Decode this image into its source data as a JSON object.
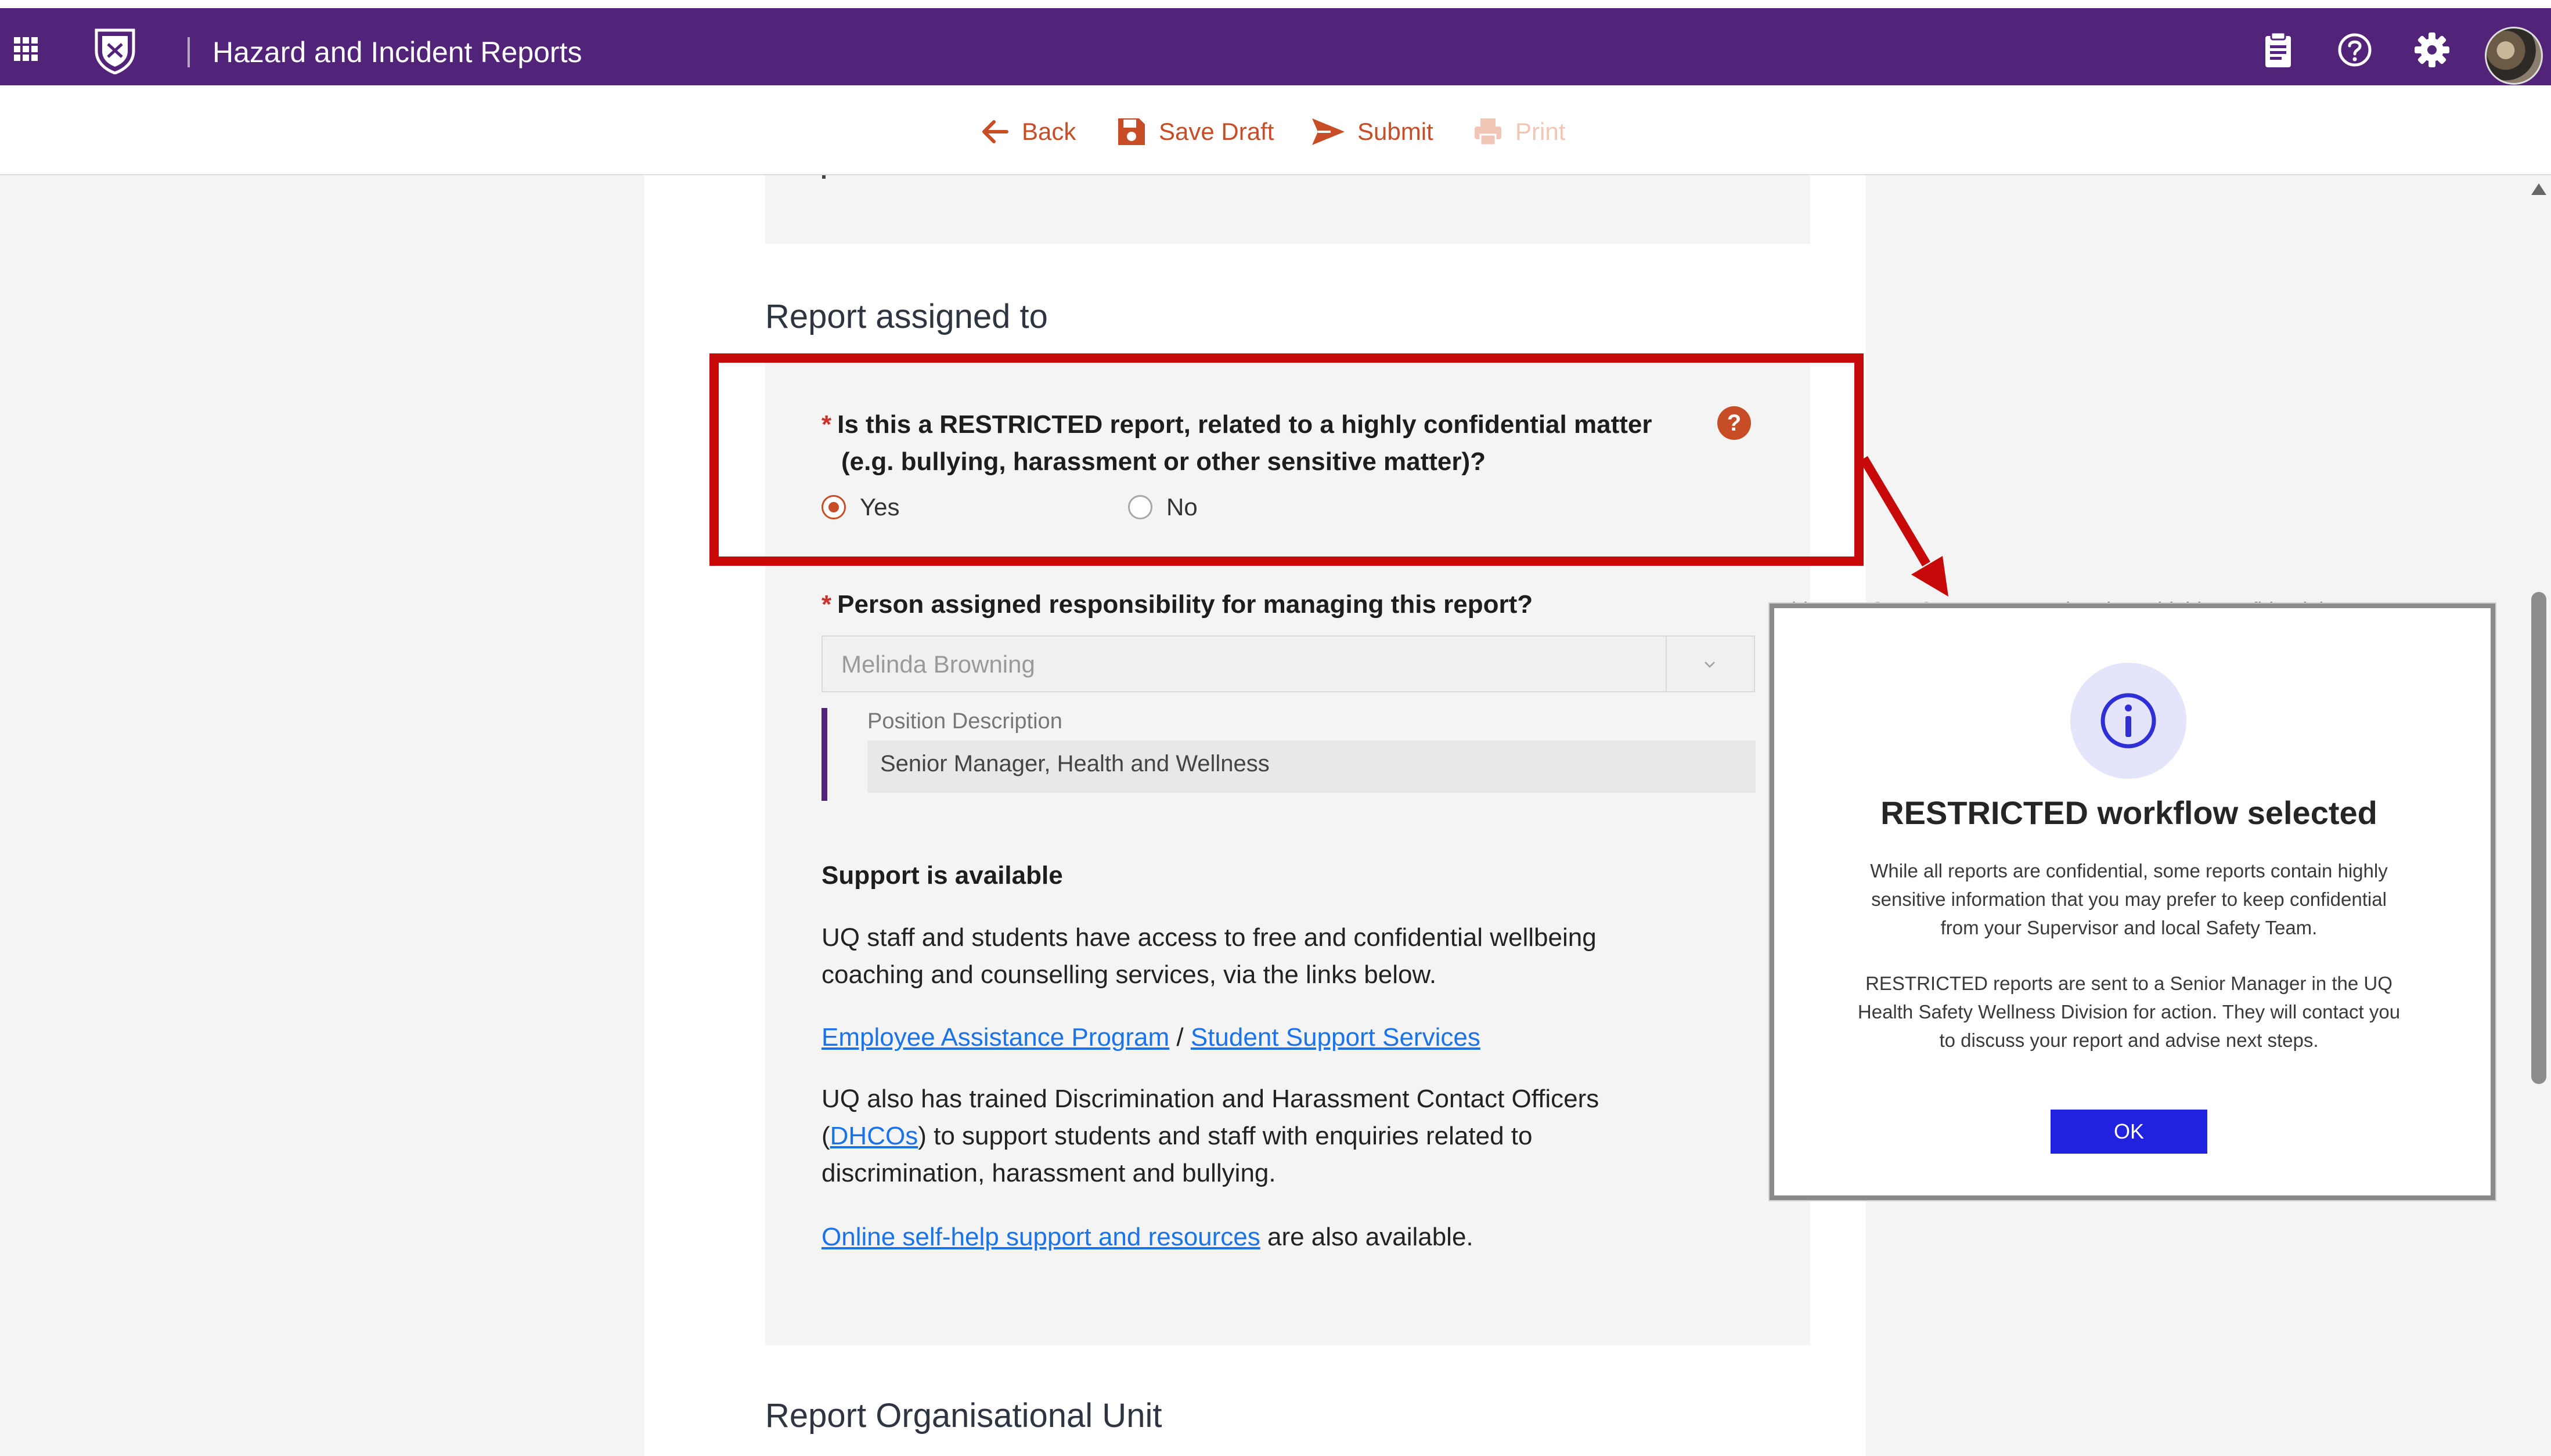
{
  "app": {
    "title": "Hazard and Incident Reports"
  },
  "toolbar": {
    "back_label": "Back",
    "save_label": "Save Draft",
    "submit_label": "Submit",
    "print_label": "Print"
  },
  "sections": {
    "assigned_title": "Report assigned to",
    "org_unit_title": "Report Organisational Unit"
  },
  "restricted_question": {
    "label_line1": "Is this a RESTRICTED report, related to a highly confidential matter",
    "label_line2": "(e.g. bullying, harassment or other sensitive matter)?",
    "help_glyph": "?",
    "options": [
      {
        "label": "Yes",
        "checked": true
      },
      {
        "label": "No",
        "checked": false
      }
    ]
  },
  "person_question": {
    "label": "Person assigned responsibility for managing this report?",
    "selected_value": "Melinda Browning",
    "position_label": "Position Description",
    "position_value": "Senior Manager, Health and Wellness"
  },
  "support": {
    "title": "Support is available",
    "para1_line1": "UQ staff and students have access to free and confidential wellbeing",
    "para1_line2": "coaching and counselling services, via the links below.",
    "link_eap": "Employee Assistance Program",
    "link_sep": "/",
    "link_sss": "Student Support Services",
    "para2_line1": "UQ also has trained Discrimination and Harassment Contact Officers",
    "para2_open": "(",
    "link_dhco": "DHCOs",
    "para2_line2_rest": ") to support students and staff with enquiries related to",
    "para2_line3": "discrimination, harassment and bullying.",
    "link_online": "Online self-help support and resources",
    "para3_rest": " are also available."
  },
  "modal": {
    "ghost_text": "s this a RESTRICTED report, related to a highly confidential matter",
    "title": "RESTRICTED workflow selected",
    "para1_line1": "While all reports are confidential, some reports contain highly",
    "para1_line2": "sensitive information that you may prefer to keep confidential",
    "para1_line3": "from your Supervisor and local Safety Team.",
    "para2_line1": "RESTRICTED reports are sent to a Senior Manager in the UQ",
    "para2_line2": "Health Safety Wellness Division for action. They will contact you",
    "para2_line3": "to discuss your report and advise next steps.",
    "ok_label": "OK"
  },
  "colors": {
    "brand_purple": "#51247a",
    "accent_orange": "#c64d25",
    "highlight_red": "#c8090a",
    "modal_button_blue": "#2121e0",
    "link_blue": "#1a73e8"
  },
  "icons": [
    "apps-grid-icon",
    "university-crest-icon",
    "clipboard-icon",
    "help-circle-icon",
    "gear-icon",
    "arrow-left-icon",
    "save-icon",
    "send-icon",
    "printer-icon",
    "info-icon",
    "chevron-down-icon"
  ]
}
